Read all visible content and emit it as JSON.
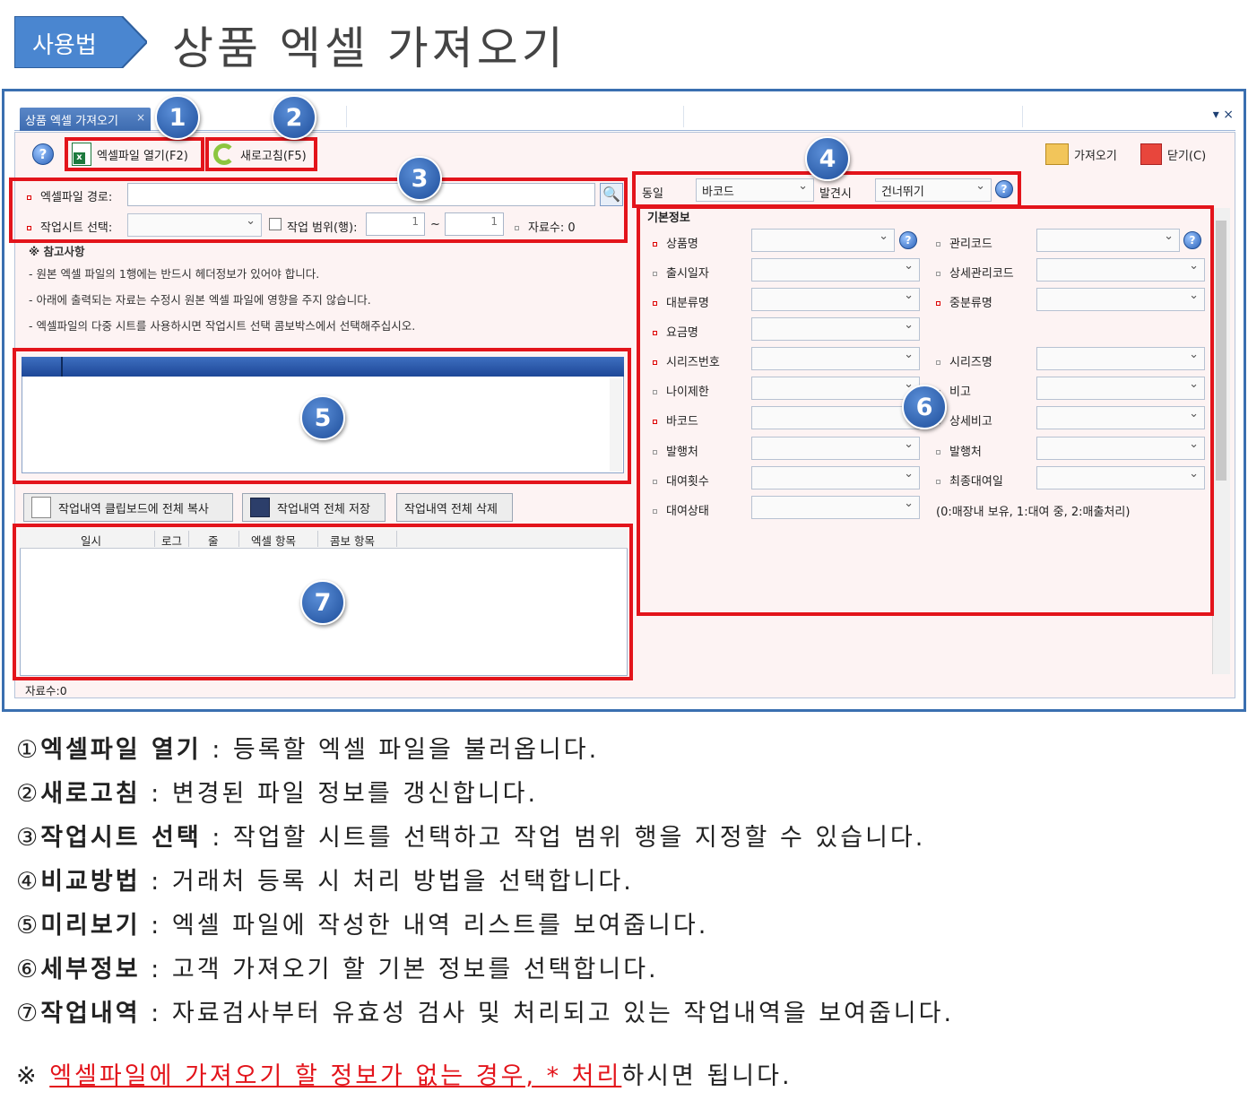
{
  "header": {
    "tag": "사용법",
    "title": "상품 엑셀 가져오기"
  },
  "window": {
    "tab_label": "상품 엑셀 가져오기",
    "tab_close": "×",
    "controls": "▾ ×"
  },
  "toolbar": {
    "open_excel": "엑셀파일 열기(F2)",
    "refresh": "새로고침(F5)",
    "import": "가져오기",
    "close": "닫기(C)"
  },
  "file": {
    "path_label": "엑셀파일 경로:",
    "path_value": "",
    "sheet_label": "작업시트 선택:",
    "range_label": "작업 범위(행):",
    "range_from": "1",
    "range_sep": "~",
    "range_to": "1",
    "count_label": "자료수: 0"
  },
  "notes": {
    "title": "※ 참고사항",
    "lines": [
      "- 원본 엑셀 파일의 1행에는 반드시 헤더정보가 있어야 합니다.",
      "- 아래에 출력되는 자료는 수정시 원본 엑셀 파일에 영향을 주지 않습니다.",
      "- 엑셀파일의 다중 시트를 사용하시면 작업시트 선택 콤보박스에서 선택해주십시오."
    ]
  },
  "compare": {
    "same_label": "동일",
    "same_value": "바코드",
    "found_label": "발견시",
    "found_value": "건너뛰기"
  },
  "basic_info": {
    "title": "기본정보",
    "left_fields": [
      "상품명",
      "출시일자",
      "대분류명",
      "요금명",
      "시리즈번호",
      "나이제한",
      "바코드",
      "발행처",
      "대여횟수",
      "대여상태"
    ],
    "right_fields": [
      "관리코드",
      "상세관리코드",
      "중분류명",
      "시리즈명",
      "비고",
      "상세비고",
      "발행처",
      "최종대여일"
    ],
    "status_hint": "(0:매장내 보유, 1:대여 중, 2:매출처리)"
  },
  "actions": {
    "copy_all": "작업내역 클립보드에 전체 복사",
    "save_all": "작업내역 전체 저장",
    "delete_all": "작업내역 전체 삭제"
  },
  "log": {
    "columns": [
      "일시",
      "로그",
      "줄",
      "엑셀 항목",
      "콤보 항목"
    ],
    "count": "자료수:0"
  },
  "badges": [
    "1",
    "2",
    "3",
    "4",
    "5",
    "6",
    "7"
  ],
  "explanations": [
    {
      "num": "①",
      "term": "엑셀파일 열기",
      "desc": " : 등록할 엑셀 파일을 불러옵니다."
    },
    {
      "num": "②",
      "term": "새로고침",
      "desc": " : 변경된 파일 정보를 갱신합니다."
    },
    {
      "num": "③",
      "term": "작업시트 선택",
      "desc": " : 작업할 시트를 선택하고 작업 범위 행을 지정할 수 있습니다."
    },
    {
      "num": "④",
      "term": "비교방법",
      "desc": " : 거래처 등록 시 처리 방법을 선택합니다."
    },
    {
      "num": "⑤",
      "term": "미리보기",
      "desc": " : 엑셀 파일에 작성한 내역 리스트를 보여줍니다."
    },
    {
      "num": "⑥",
      "term": "세부정보",
      "desc": " : 고객 가져오기 할 기본 정보를 선택합니다."
    },
    {
      "num": "⑦",
      "term": "작업내역",
      "desc": " : 자료검사부터 유효성 검사 및 처리되고 있는 작업내역을 보여줍니다."
    }
  ],
  "footnote": {
    "mark": "※",
    "red": "엑셀파일에 가져오기 할 정보가 없는 경우, * 처리",
    "rest": "하시면 됩니다."
  },
  "colors": {
    "accent": "#3a6fb0",
    "highlight": "#e3141b",
    "badge": "#1d4d9a"
  }
}
